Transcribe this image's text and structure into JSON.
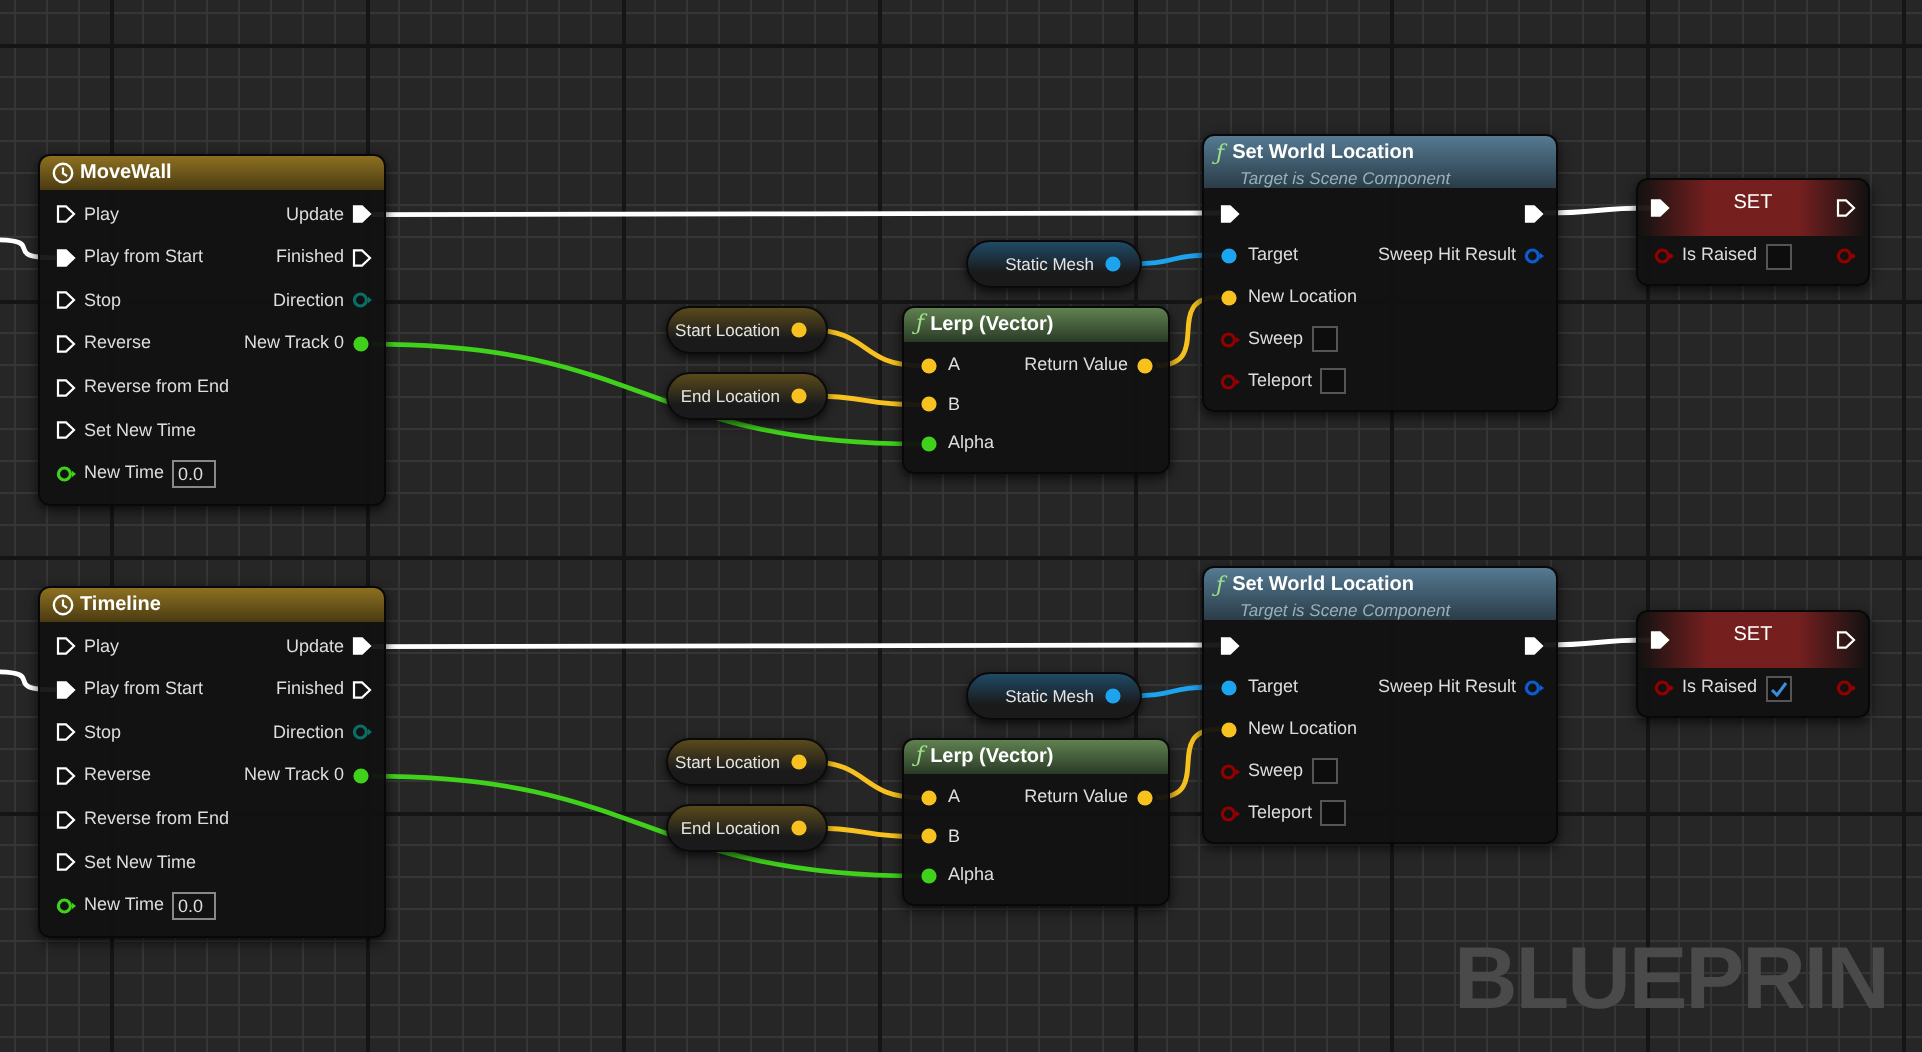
{
  "graphs": [
    {
      "timeline": {
        "title": "MoveWall",
        "inputs": [
          {
            "label": "Play",
            "kind": "exec",
            "connected": false
          },
          {
            "label": "Play from Start",
            "kind": "exec",
            "connected": true
          },
          {
            "label": "Stop",
            "kind": "exec",
            "connected": false
          },
          {
            "label": "Reverse",
            "kind": "exec",
            "connected": false
          },
          {
            "label": "Reverse from End",
            "kind": "exec",
            "connected": false
          },
          {
            "label": "Set New Time",
            "kind": "exec",
            "connected": false
          },
          {
            "label": "New Time",
            "kind": "float",
            "connected": false,
            "value": "0.0"
          }
        ],
        "outputs": [
          {
            "label": "Update",
            "kind": "exec",
            "connected": true
          },
          {
            "label": "Finished",
            "kind": "exec",
            "connected": false
          },
          {
            "label": "Direction",
            "kind": "enum",
            "connected": false
          },
          {
            "label": "New Track 0",
            "kind": "float",
            "connected": true
          }
        ]
      },
      "variables": [
        {
          "label": "Static Mesh",
          "kind": "object"
        },
        {
          "label": "Start Location",
          "kind": "vector"
        },
        {
          "label": "End Location",
          "kind": "vector"
        }
      ],
      "lerp": {
        "icon_glyph": "ƒ",
        "title": "Lerp (Vector)",
        "inputs": [
          {
            "label": "A",
            "kind": "vector",
            "connected": true
          },
          {
            "label": "B",
            "kind": "vector",
            "connected": true
          },
          {
            "label": "Alpha",
            "kind": "float",
            "connected": true
          }
        ],
        "outputs": [
          {
            "label": "Return Value",
            "kind": "vector",
            "connected": true
          }
        ]
      },
      "set_location": {
        "icon_glyph": "ƒ",
        "title": "Set World Location",
        "subtitle": "Target is Scene Component",
        "inputs": [
          {
            "kind": "exec",
            "connected": true
          },
          {
            "label": "Target",
            "kind": "object",
            "connected": true
          },
          {
            "label": "New Location",
            "kind": "vector",
            "connected": true
          },
          {
            "label": "Sweep",
            "kind": "bool",
            "connected": false,
            "checked": false
          },
          {
            "label": "Teleport",
            "kind": "bool",
            "connected": false,
            "checked": false
          }
        ],
        "outputs": [
          {
            "kind": "exec",
            "connected": true
          },
          {
            "label": "Sweep Hit Result",
            "kind": "struct",
            "connected": false
          }
        ]
      },
      "set_node": {
        "title": "SET",
        "inputs": [
          {
            "kind": "exec",
            "connected": true
          },
          {
            "label": "Is Raised",
            "kind": "bool",
            "connected": false,
            "checked": false
          }
        ],
        "outputs": [
          {
            "kind": "exec",
            "connected": false
          },
          {
            "kind": "bool",
            "connected": false
          }
        ]
      }
    },
    {
      "timeline": {
        "title": "Timeline",
        "inputs": [
          {
            "label": "Play",
            "kind": "exec",
            "connected": false
          },
          {
            "label": "Play from Start",
            "kind": "exec",
            "connected": true
          },
          {
            "label": "Stop",
            "kind": "exec",
            "connected": false
          },
          {
            "label": "Reverse",
            "kind": "exec",
            "connected": false
          },
          {
            "label": "Reverse from End",
            "kind": "exec",
            "connected": false
          },
          {
            "label": "Set New Time",
            "kind": "exec",
            "connected": false
          },
          {
            "label": "New Time",
            "kind": "float",
            "connected": false,
            "value": "0.0"
          }
        ],
        "outputs": [
          {
            "label": "Update",
            "kind": "exec",
            "connected": true
          },
          {
            "label": "Finished",
            "kind": "exec",
            "connected": false
          },
          {
            "label": "Direction",
            "kind": "enum",
            "connected": false
          },
          {
            "label": "New Track 0",
            "kind": "float",
            "connected": true
          }
        ]
      },
      "variables": [
        {
          "label": "Static Mesh",
          "kind": "object"
        },
        {
          "label": "Start Location",
          "kind": "vector"
        },
        {
          "label": "End Location",
          "kind": "vector"
        }
      ],
      "lerp": {
        "icon_glyph": "ƒ",
        "title": "Lerp (Vector)",
        "inputs": [
          {
            "label": "A",
            "kind": "vector",
            "connected": true
          },
          {
            "label": "B",
            "kind": "vector",
            "connected": true
          },
          {
            "label": "Alpha",
            "kind": "float",
            "connected": true
          }
        ],
        "outputs": [
          {
            "label": "Return Value",
            "kind": "vector",
            "connected": true
          }
        ]
      },
      "set_location": {
        "icon_glyph": "ƒ",
        "title": "Set World Location",
        "subtitle": "Target is Scene Component",
        "inputs": [
          {
            "kind": "exec",
            "connected": true
          },
          {
            "label": "Target",
            "kind": "object",
            "connected": true
          },
          {
            "label": "New Location",
            "kind": "vector",
            "connected": true
          },
          {
            "label": "Sweep",
            "kind": "bool",
            "connected": false,
            "checked": false
          },
          {
            "label": "Teleport",
            "kind": "bool",
            "connected": false,
            "checked": false
          }
        ],
        "outputs": [
          {
            "kind": "exec",
            "connected": true
          },
          {
            "label": "Sweep Hit Result",
            "kind": "struct",
            "connected": false
          }
        ]
      },
      "set_node": {
        "title": "SET",
        "inputs": [
          {
            "kind": "exec",
            "connected": true
          },
          {
            "label": "Is Raised",
            "kind": "bool",
            "connected": false,
            "checked": true
          }
        ],
        "outputs": [
          {
            "kind": "exec",
            "connected": false
          },
          {
            "kind": "bool",
            "connected": false
          }
        ]
      }
    }
  ],
  "graph_label": "BLUEPRIN"
}
